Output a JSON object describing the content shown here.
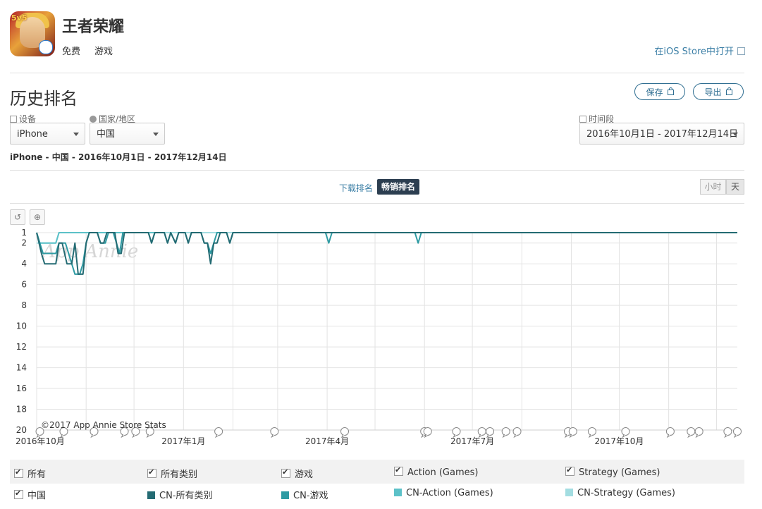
{
  "app": {
    "name": "王者荣耀",
    "price_tag": "免费",
    "category_tag": "游戏",
    "store_link": "在iOS Store中打开",
    "icon": "app-icon-5v5"
  },
  "page": {
    "title": "历史排名",
    "save_label": "保存",
    "export_label": "导出"
  },
  "filters": {
    "device_label": "设备",
    "device_value": "iPhone",
    "country_label": "国家/地区",
    "country_value": "中国",
    "period_label": "时间段",
    "period_value": "2016年10月1日 - 2017年12月14日"
  },
  "breadcrumb": "iPhone - 中国 - 2016年10月1日 - 2017年12月14日",
  "tabs": {
    "download": "下载排名",
    "grossing": "畅销排名"
  },
  "granularity": {
    "hour": "小时",
    "day": "天"
  },
  "toolbar": {
    "reset_icon": "undo-icon",
    "zoom_icon": "zoom-in-icon"
  },
  "watermark": "App Annie",
  "credit": "©2017 App Annie Store Stats",
  "colors": {
    "all_categories": "#246b73",
    "games": "#2e9ba3",
    "action": "#5cc1c8",
    "strategy": "#a3dde1",
    "accent": "#2c3e50",
    "link": "#3c7fa6"
  },
  "chart_data": {
    "type": "line",
    "y_inverted": true,
    "ylim": [
      1,
      20
    ],
    "yticks": [
      "1",
      "2",
      "4",
      "6",
      "8",
      "10",
      "12",
      "14",
      "16",
      "18",
      "20"
    ],
    "x_start": "2016-10-01",
    "x_end": "2017-12-14",
    "xticks": [
      "2016年10月",
      "2017年1月",
      "2017年4月",
      "2017年7月",
      "2017年10月"
    ],
    "series": [
      {
        "name": "CN-所有类别",
        "points": [
          [
            "2016-10-01",
            1
          ],
          [
            "2016-10-04",
            3
          ],
          [
            "2016-10-06",
            4
          ],
          [
            "2016-10-13",
            4
          ],
          [
            "2016-10-15",
            2
          ],
          [
            "2016-10-17",
            2
          ],
          [
            "2016-10-20",
            4
          ],
          [
            "2016-10-23",
            4
          ],
          [
            "2016-10-25",
            2
          ],
          [
            "2016-10-27",
            5
          ],
          [
            "2016-10-30",
            5
          ],
          [
            "2016-11-01",
            2
          ],
          [
            "2016-11-03",
            1
          ],
          [
            "2016-11-08",
            1
          ],
          [
            "2016-11-10",
            2
          ],
          [
            "2016-11-12",
            2
          ],
          [
            "2016-11-14",
            1
          ],
          [
            "2016-11-19",
            1
          ],
          [
            "2016-11-21",
            3
          ],
          [
            "2016-11-23",
            3
          ],
          [
            "2016-11-25",
            1
          ],
          [
            "2016-12-10",
            1
          ],
          [
            "2016-12-12",
            2
          ],
          [
            "2016-12-14",
            1
          ],
          [
            "2016-12-20",
            1
          ],
          [
            "2016-12-22",
            2
          ],
          [
            "2016-12-24",
            1
          ],
          [
            "2016-12-27",
            2
          ],
          [
            "2016-12-29",
            1
          ],
          [
            "2017-01-02",
            1
          ],
          [
            "2017-01-04",
            2
          ],
          [
            "2017-01-06",
            1
          ],
          [
            "2017-01-12",
            1
          ],
          [
            "2017-01-14",
            2
          ],
          [
            "2017-01-16",
            2
          ],
          [
            "2017-01-18",
            4
          ],
          [
            "2017-01-20",
            2
          ],
          [
            "2017-01-22",
            2
          ],
          [
            "2017-01-24",
            1
          ],
          [
            "2017-01-28",
            1
          ],
          [
            "2017-01-30",
            2
          ],
          [
            "2017-02-01",
            1
          ],
          [
            "2017-12-14",
            1
          ]
        ]
      },
      {
        "name": "CN-游戏",
        "points": [
          [
            "2016-10-01",
            1
          ],
          [
            "2016-10-03",
            2
          ],
          [
            "2016-10-05",
            3
          ],
          [
            "2016-10-13",
            3
          ],
          [
            "2016-10-15",
            2
          ],
          [
            "2016-10-19",
            2
          ],
          [
            "2016-10-21",
            3
          ],
          [
            "2016-10-23",
            4
          ],
          [
            "2016-10-25",
            5
          ],
          [
            "2016-10-28",
            5
          ],
          [
            "2016-10-30",
            4
          ],
          [
            "2016-11-01",
            2
          ],
          [
            "2016-11-03",
            1
          ],
          [
            "2016-11-08",
            1
          ],
          [
            "2016-11-10",
            2
          ],
          [
            "2016-11-13",
            2
          ],
          [
            "2016-11-15",
            1
          ],
          [
            "2016-11-18",
            1
          ],
          [
            "2016-11-20",
            2
          ],
          [
            "2016-11-22",
            3
          ],
          [
            "2016-11-24",
            1
          ],
          [
            "2016-12-10",
            1
          ],
          [
            "2016-12-12",
            2
          ],
          [
            "2016-12-14",
            1
          ],
          [
            "2016-12-20",
            1
          ],
          [
            "2016-12-22",
            2
          ],
          [
            "2016-12-24",
            1
          ],
          [
            "2016-12-27",
            2
          ],
          [
            "2016-12-29",
            1
          ],
          [
            "2017-01-02",
            1
          ],
          [
            "2017-01-04",
            2
          ],
          [
            "2017-01-06",
            1
          ],
          [
            "2017-01-12",
            1
          ],
          [
            "2017-01-14",
            2
          ],
          [
            "2017-01-16",
            2
          ],
          [
            "2017-01-18",
            3
          ],
          [
            "2017-01-20",
            2
          ],
          [
            "2017-01-22",
            1
          ],
          [
            "2017-01-28",
            1
          ],
          [
            "2017-01-30",
            2
          ],
          [
            "2017-02-01",
            1
          ],
          [
            "2017-03-31",
            1
          ],
          [
            "2017-04-02",
            2
          ],
          [
            "2017-04-04",
            1
          ],
          [
            "2017-05-26",
            1
          ],
          [
            "2017-05-28",
            2
          ],
          [
            "2017-05-30",
            1
          ],
          [
            "2017-12-14",
            1
          ]
        ]
      },
      {
        "name": "CN-Action (Games)",
        "points": [
          [
            "2016-10-01",
            1
          ],
          [
            "2016-10-03",
            2
          ],
          [
            "2016-10-13",
            2
          ],
          [
            "2016-10-15",
            1
          ],
          [
            "2016-12-14",
            1
          ]
        ]
      },
      {
        "name": "CN-Strategy (Games)",
        "points": [
          [
            "2016-10-01",
            2
          ],
          [
            "2016-10-13",
            2
          ],
          [
            "2016-10-15",
            1
          ],
          [
            "2017-12-14",
            1
          ]
        ]
      }
    ],
    "event_markers": [
      "2016-10-03",
      "2016-10-18",
      "2016-11-06",
      "2016-11-25",
      "2016-12-02",
      "2016-12-11",
      "2017-01-23",
      "2017-02-27",
      "2017-04-12",
      "2017-06-01",
      "2017-06-03",
      "2017-06-21",
      "2017-07-07",
      "2017-07-12",
      "2017-07-22",
      "2017-07-29",
      "2017-08-30",
      "2017-09-02",
      "2017-09-14",
      "2017-10-05",
      "2017-11-02",
      "2017-11-15",
      "2017-11-20",
      "2017-12-08",
      "2017-12-14"
    ]
  },
  "legend": {
    "all": "所有",
    "all_categories": "所有类别",
    "games": "游戏",
    "action": "Action (Games)",
    "strategy": "Strategy (Games)",
    "country": "中国",
    "cn_all_categories": "CN-所有类别",
    "cn_games": "CN-游戏",
    "cn_action": "CN-Action (Games)",
    "cn_strategy": "CN-Strategy (Games)"
  }
}
